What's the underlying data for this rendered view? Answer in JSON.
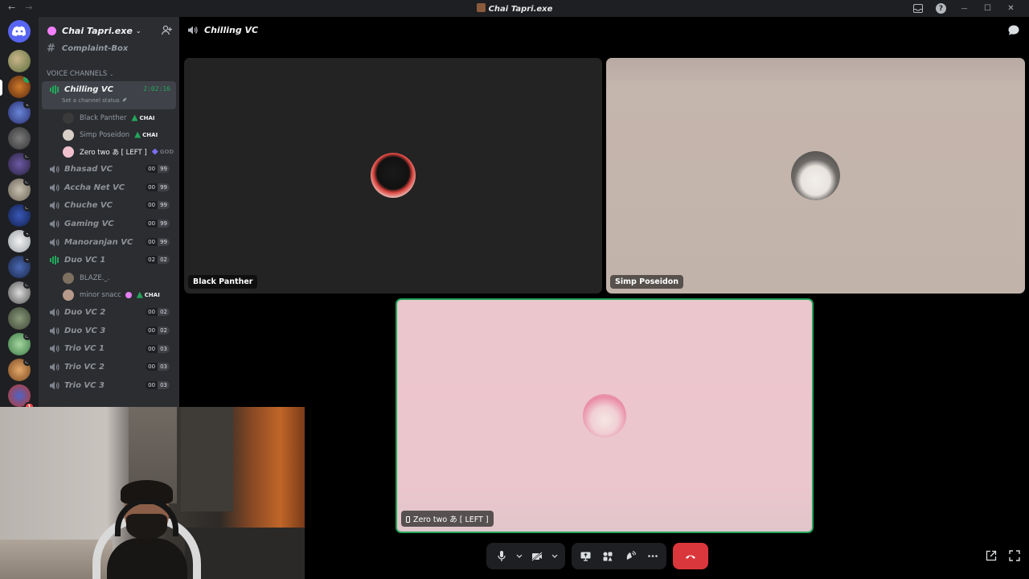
{
  "window": {
    "title": "Chai Tapri.exe",
    "back": "←",
    "forward": "→",
    "minimize": "—",
    "maximize": "☐",
    "close": "✕",
    "help": "?"
  },
  "server": {
    "name": "Chai Tapri.exe"
  },
  "servers": {
    "mention_count": "1"
  },
  "sidebar": {
    "text_channel": "Complaint-Box",
    "category": "VOICE CHANNELS",
    "active_vc": {
      "name": "Chilling VC",
      "timer": "2:02:16",
      "status": "Set a channel status"
    },
    "members_active": [
      {
        "name": "Black Panther",
        "tag": "CHAI",
        "avatar_color": "#3a3a3a"
      },
      {
        "name": "Simp Poseidon",
        "tag": "CHAI",
        "avatar_color": "#d8d0c8"
      },
      {
        "name": "Zero two あ [ LEFT ]",
        "tag": "GOD",
        "avatar_color": "#efc1cd"
      }
    ],
    "channels_a": [
      {
        "name": "Bhasad VC",
        "count": "00",
        "limit": "99"
      },
      {
        "name": "Accha Net VC",
        "count": "00",
        "limit": "99"
      },
      {
        "name": "Chuche VC",
        "count": "00",
        "limit": "99"
      },
      {
        "name": "Gaming VC",
        "count": "00",
        "limit": "99"
      },
      {
        "name": "Manoranjan VC",
        "count": "00",
        "limit": "99"
      }
    ],
    "duo1": {
      "name": "Duo VC 1",
      "count": "02",
      "limit": "02"
    },
    "duo1_members": [
      {
        "name": "BLAZE._.",
        "tag": "",
        "avatar_color": "#7d7060"
      },
      {
        "name": "minor snacc",
        "tag": "CHAI",
        "avatar_color": "#b79a8a"
      }
    ],
    "channels_b": [
      {
        "name": "Duo VC 2",
        "count": "00",
        "limit": "02"
      },
      {
        "name": "Duo VC 3",
        "count": "00",
        "limit": "02"
      },
      {
        "name": "Trio VC 1",
        "count": "00",
        "limit": "03"
      },
      {
        "name": "Trio VC 2",
        "count": "00",
        "limit": "03"
      },
      {
        "name": "Trio VC 3",
        "count": "00",
        "limit": "03"
      }
    ]
  },
  "voice_header": {
    "channel": "Chilling VC"
  },
  "tiles": [
    {
      "name": "Black Panther"
    },
    {
      "name": "Simp Poseidon"
    },
    {
      "name": "Zero two あ [ LEFT ]"
    }
  ],
  "controls": {
    "icons": [
      "microphone-icon",
      "chevron-down-icon",
      "camera-off-icon",
      "chevron-down-icon",
      "screen-share-icon",
      "activities-icon",
      "soundboard-icon",
      "more-icon",
      "hang-up-icon"
    ]
  },
  "colors": {
    "accent_green": "#23a55a",
    "hangup_red": "#da373c",
    "brand": "#5865f2"
  }
}
